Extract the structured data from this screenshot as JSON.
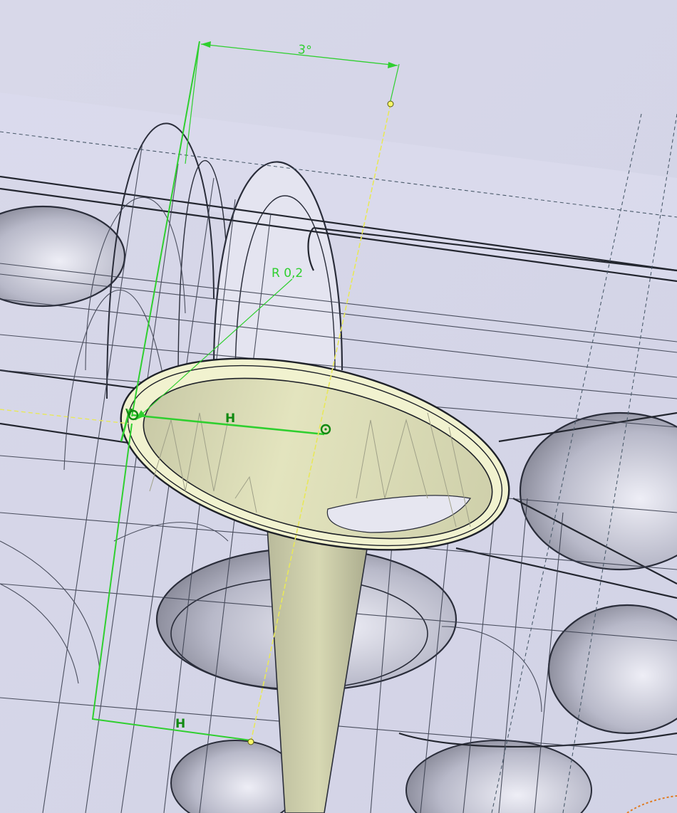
{
  "viewer": {
    "background": "#d9d9e8",
    "edge_color": "#2a2d3a",
    "hidden_edge_color": "#3c4050",
    "sketch_color": "#2fcf2f",
    "constraint_color": "#118a11",
    "highlight_face": "#f1f2cf",
    "axis_color": "#e8e85a"
  },
  "dimensions": {
    "angle": "3°",
    "radius": "R 0,2"
  },
  "constraints": {
    "horizontal_top": "H",
    "horizontal_bottom": "H",
    "vertical_symbol": "V",
    "coincident_symbol": "◎"
  }
}
